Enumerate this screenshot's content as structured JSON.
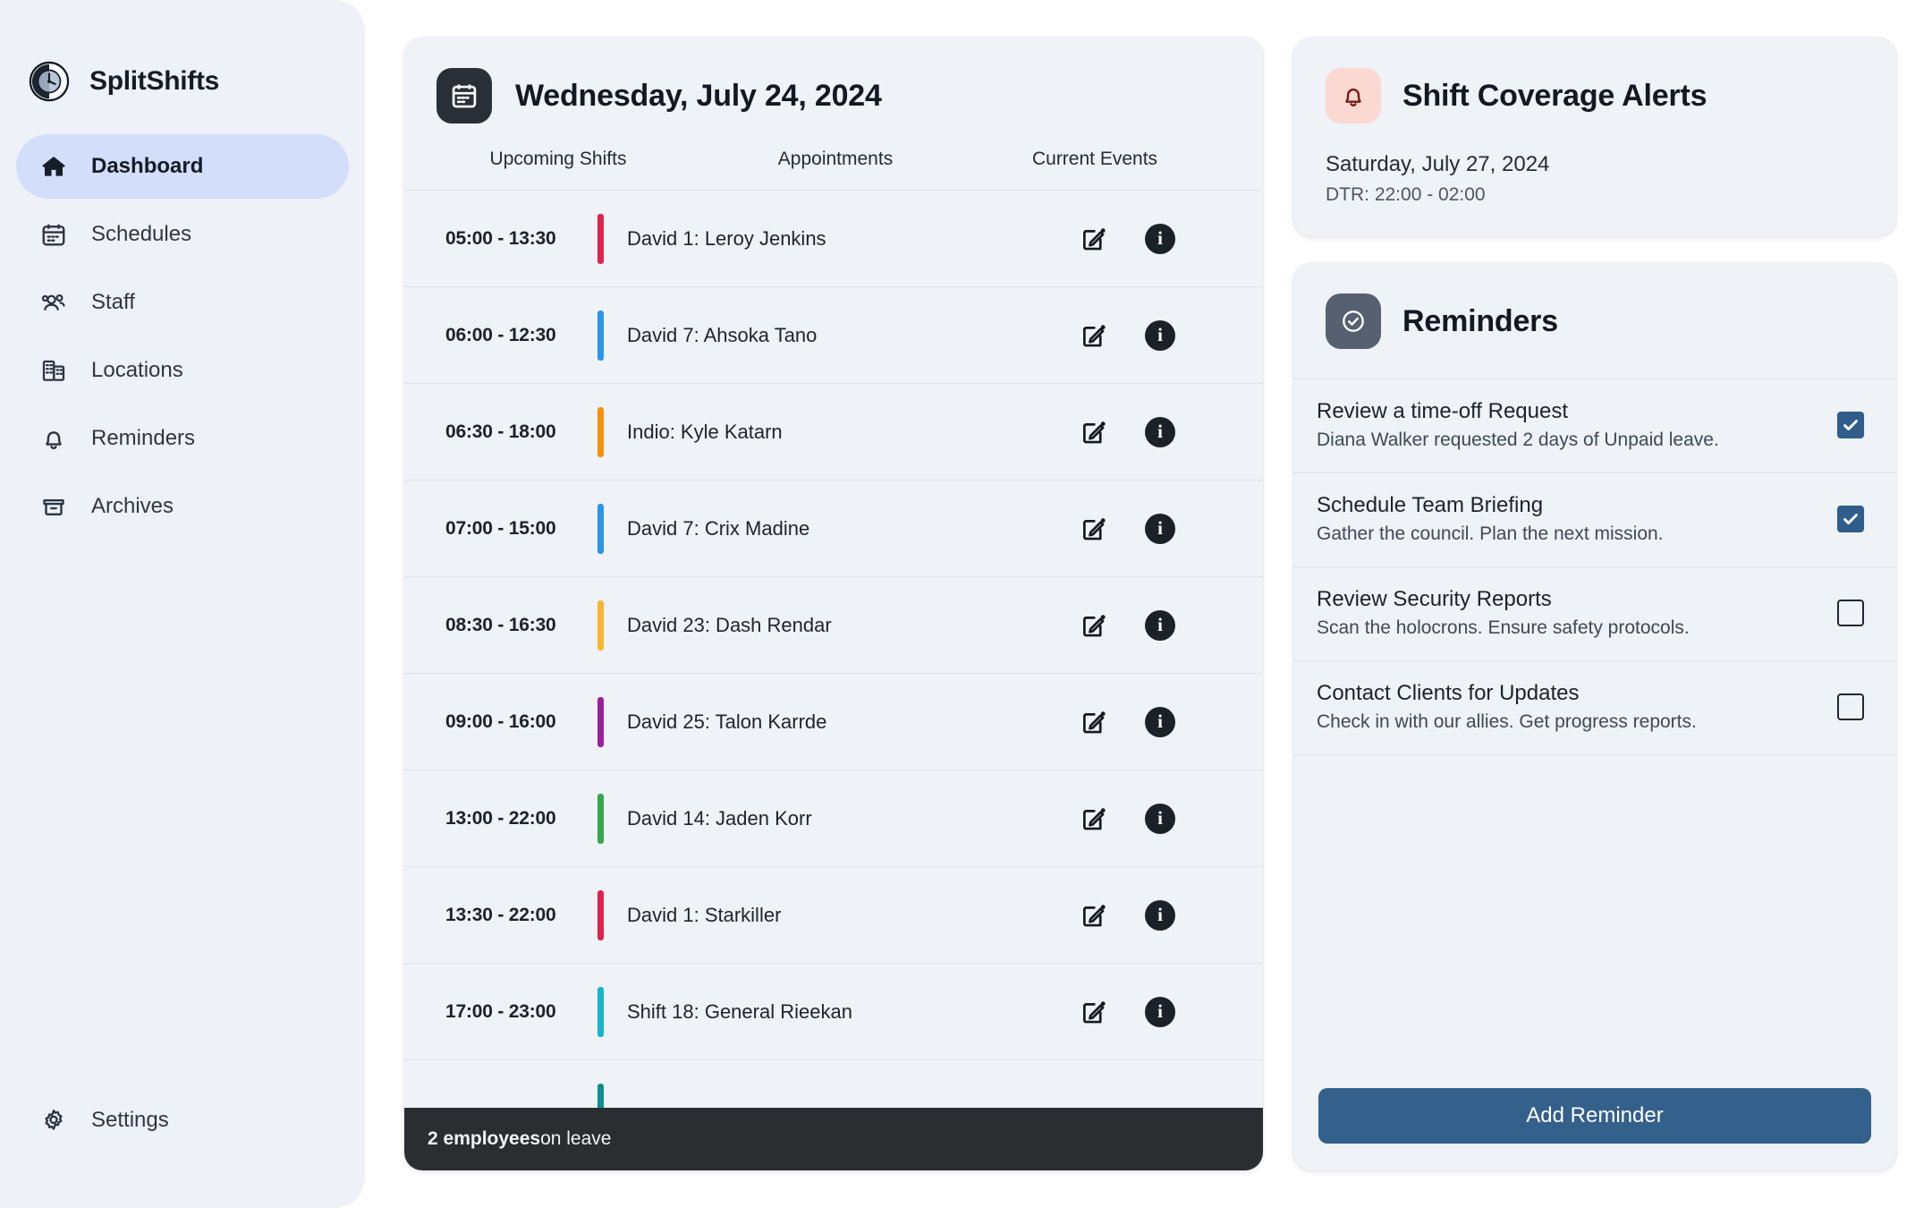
{
  "brand": {
    "name": "SplitShifts",
    "logo_icon": "clock-split-logo-icon"
  },
  "sidebar": {
    "items": [
      {
        "label": "Dashboard",
        "icon": "home-icon",
        "active": true
      },
      {
        "label": "Schedules",
        "icon": "calendar-icon",
        "active": false
      },
      {
        "label": "Staff",
        "icon": "users-icon",
        "active": false
      },
      {
        "label": "Locations",
        "icon": "building-icon",
        "active": false
      },
      {
        "label": "Reminders",
        "icon": "bell-icon",
        "active": false
      },
      {
        "label": "Archives",
        "icon": "archive-icon",
        "active": false
      }
    ],
    "footer": {
      "label": "Settings",
      "icon": "gear-icon"
    }
  },
  "schedule": {
    "icon": "calendar-icon",
    "title": "Wednesday, July 24, 2024",
    "columns": [
      "Upcoming Shifts",
      "Appointments",
      "Current Events"
    ],
    "row_icons": {
      "edit": "edit-pencil-icon",
      "info": "info-icon"
    },
    "rows": [
      {
        "time": "05:00 - 13:30",
        "name": "David 1: Leroy Jenkins",
        "color": "#e0234e"
      },
      {
        "time": "06:00 - 12:30",
        "name": "David 7: Ahsoka Tano",
        "color": "#2b95e8"
      },
      {
        "time": "06:30 - 18:00",
        "name": "Indio: Kyle Katarn",
        "color": "#f5920b"
      },
      {
        "time": "07:00 - 15:00",
        "name": "David 7: Crix Madine",
        "color": "#2b95e8"
      },
      {
        "time": "08:30 - 16:30",
        "name": "David 23: Dash Rendar",
        "color": "#f5b731"
      },
      {
        "time": "09:00 - 16:00",
        "name": "David 25: Talon Karrde",
        "color": "#9b1fa0"
      },
      {
        "time": "13:00 - 22:00",
        "name": "David 14: Jaden Korr",
        "color": "#34a84b"
      },
      {
        "time": "13:30 - 22:00",
        "name": "David 1: Starkiller",
        "color": "#e0234e"
      },
      {
        "time": "17:00 - 23:00",
        "name": "Shift 18: General Rieekan",
        "color": "#14b6cd"
      },
      {
        "time": "",
        "name": "",
        "color": "#0e8f8f"
      }
    ],
    "toast": {
      "count": "2 employees",
      "rest": " on leave"
    }
  },
  "alerts": {
    "icon": "bell-icon",
    "title": "Shift Coverage Alerts",
    "date": "Saturday, July 27, 2024",
    "dtr": "DTR: 22:00 - 02:00"
  },
  "reminders": {
    "icon": "check-circle-icon",
    "title": "Reminders",
    "items": [
      {
        "name": "Review a time-off Request",
        "desc": "Diana Walker requested 2 days of Unpaid leave.",
        "checked": true
      },
      {
        "name": "Schedule Team Briefing",
        "desc": "Gather the council. Plan the next mission.",
        "checked": true
      },
      {
        "name": "Review Security Reports",
        "desc": "Scan the holocrons. Ensure safety protocols.",
        "checked": false
      },
      {
        "name": "Contact Clients for Updates",
        "desc": "Check in with our allies. Get progress reports.",
        "checked": false
      }
    ],
    "add_button": "Add Reminder"
  }
}
